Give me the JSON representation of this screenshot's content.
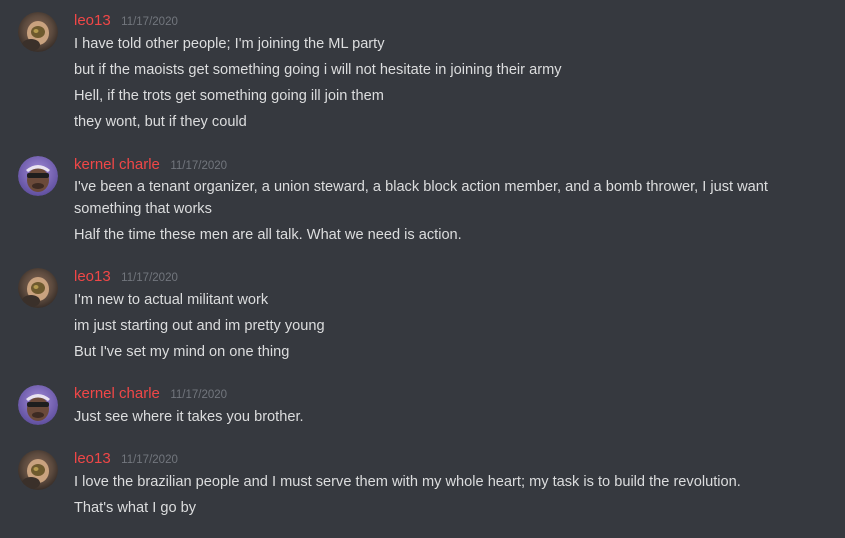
{
  "colors": {
    "background": "#36393f",
    "username": "#f04747",
    "timestamp": "#72767d",
    "message_text": "#dcddde"
  },
  "messages": [
    {
      "author": "leo13",
      "timestamp": "11/17/2020",
      "avatar_icon": "leo13-avatar",
      "lines": [
        "I have told other people; I'm joining the ML party",
        "but if the maoists get something going i will not hesitate in joining their army",
        "Hell, if the trots get something going ill join them",
        "they wont, but if they could"
      ]
    },
    {
      "author": "kernel charle",
      "timestamp": "11/17/2020",
      "avatar_icon": "kernel-charle-avatar",
      "lines": [
        "I've been a tenant organizer, a union steward, a black block action member, and a bomb thrower, I just want something that works",
        "Half the time these men are all talk. What we need is action."
      ]
    },
    {
      "author": "leo13",
      "timestamp": "11/17/2020",
      "avatar_icon": "leo13-avatar",
      "lines": [
        "I'm new to actual militant work",
        "im just starting out and im pretty young",
        "But I've set my mind on one thing"
      ]
    },
    {
      "author": "kernel charle",
      "timestamp": "11/17/2020",
      "avatar_icon": "kernel-charle-avatar",
      "lines": [
        "Just see where it takes you brother."
      ]
    },
    {
      "author": "leo13",
      "timestamp": "11/17/2020",
      "avatar_icon": "leo13-avatar",
      "lines": [
        "I love the brazilian people and I must serve them with my whole heart; my task is to build the revolution.",
        "That's what I go by"
      ]
    }
  ]
}
